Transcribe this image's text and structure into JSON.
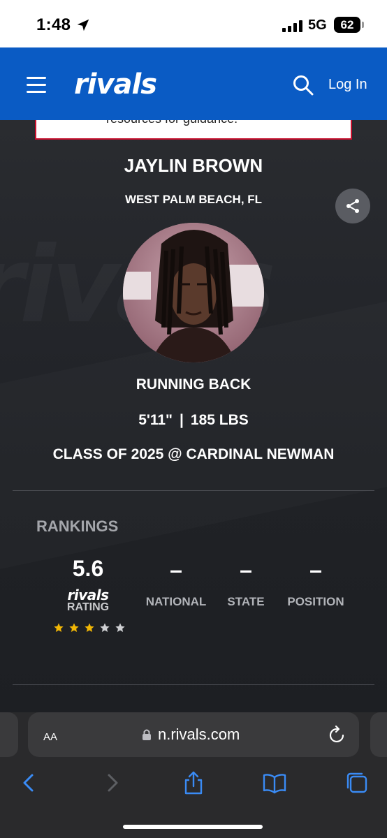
{
  "status_bar": {
    "time": "1:48",
    "network": "5G",
    "battery": "62"
  },
  "header": {
    "logo": "rivals",
    "login_label": "Log In",
    "brand_color": "#0a5bc4"
  },
  "ad": {
    "text": "resources for guidance."
  },
  "player": {
    "name": "JAYLIN BROWN",
    "hometown": "WEST PALM BEACH, FL",
    "position": "RUNNING BACK",
    "height": "5'11\"",
    "separator": "|",
    "weight": "185 LBS",
    "class_line": "CLASS OF 2025 @ CARDINAL NEWMAN"
  },
  "rankings": {
    "heading": "RANKINGS",
    "rating_value": "5.6",
    "rating_brand": "rivals",
    "rating_label": "RATING",
    "stars_filled": 3,
    "stars_total": 5,
    "star_color": "#f2b705",
    "columns": [
      {
        "value": "–",
        "label": "NATIONAL"
      },
      {
        "value": "–",
        "label": "STATE"
      },
      {
        "value": "–",
        "label": "POSITION"
      }
    ]
  },
  "browser": {
    "aa_label": "AA",
    "url": "n.rivals.com"
  }
}
